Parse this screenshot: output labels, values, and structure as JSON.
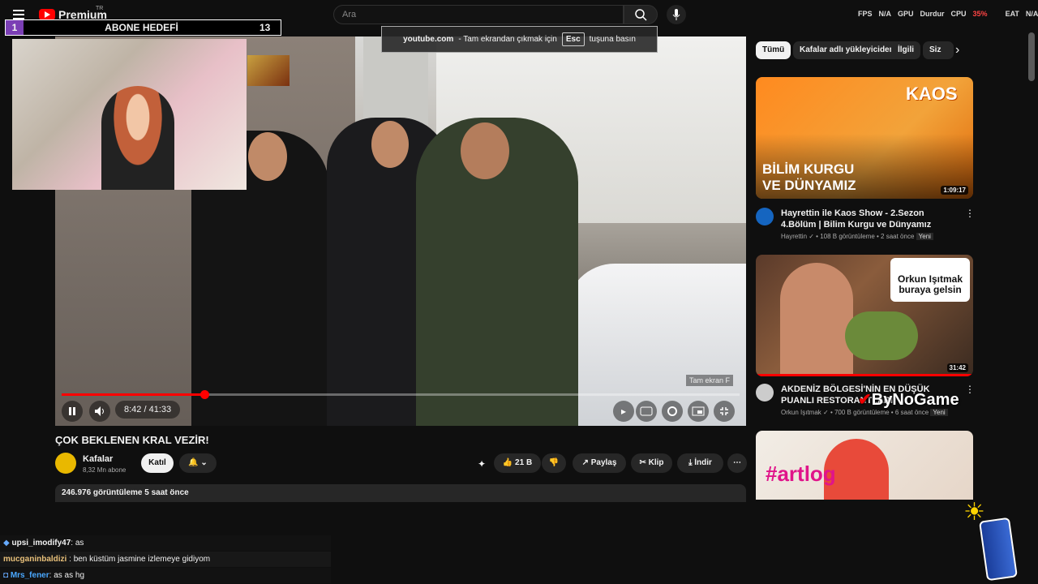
{
  "header": {
    "logo_text": "Premium",
    "country_code": "TR",
    "search_placeholder": "Ara",
    "hud_fps": "FPS",
    "hud_fps_value": "N/A",
    "hud_cpu": "CPU",
    "hud_cpu_value": "35%",
    "hud_gpu": "GPU",
    "hud_gpu_value": "Durdur",
    "hud_eat": "EAT",
    "hud_eat_value": "N/A"
  },
  "overlay": {
    "goal_index": "1",
    "goal_title": "ABONE HEDEFİ",
    "goal_count": "13",
    "fullscreen_site": "youtube.com",
    "fullscreen_msg_before": "- Tam ekrandan çıkmak için",
    "fullscreen_key": "Esc",
    "fullscreen_msg_after": "tuşuna basın",
    "fullscreen_hint": "Tam ekran",
    "fullscreen_hint_key": "F"
  },
  "player": {
    "time": "8:42 / 41:33",
    "progress": 0.21
  },
  "video": {
    "title": "ÇOK BEKLENEN KRAL VEZİR!",
    "channel": "Kafalar",
    "subscribers": "8,32 Mn abone",
    "join_label": "Katıl",
    "likes": "21 B",
    "share_label": "Paylaş",
    "clip_label": "Klip",
    "download_label": "İndir",
    "views_date": "246.976 görüntüleme  5 saat önce"
  },
  "sidebar": {
    "chips": [
      "Tümü",
      "Kafalar adlı yükleyiciden",
      "İlgili",
      "Siz"
    ],
    "videos": [
      {
        "thumb_title_line1": "BİLİM KURGU",
        "thumb_title_line2": "VE DÜNYAMIZ",
        "thumb_brand": "KAOS",
        "duration": "1:09:17",
        "title": "Hayrettin ile Kaos Show - 2.Sezon 4.Bölüm | Bilim Kurgu ve Dünyamız",
        "channel": "Hayrettin",
        "meta": "108 B görüntüleme • 2 saat önce",
        "badge": "Yeni"
      },
      {
        "thumb_caption": "Orkun Işıtmak buraya gelsin",
        "duration": "31:42",
        "title": "AKDENİZ BÖLGESİ'NİN EN DÜŞÜK PUANLI RESTORANTLARI!",
        "channel": "Orkun Işıtmak",
        "meta": "700 B görüntüleme • 6 saat önce",
        "badge": "Yeni"
      },
      {
        "thumb_caption": "#artlog"
      }
    ]
  },
  "watermark": "ByNoGame",
  "chat": [
    {
      "user": "upsi_imodify47",
      "message": "as",
      "color": "#f1f1f1"
    },
    {
      "user": "mucganinbaldizi",
      "message": "ben küstüm jasmine izlemeye gidiyom",
      "color": "#e8c07a"
    },
    {
      "user": "Mrs_fener",
      "message": "as as hg",
      "color": "#4aa8ff"
    }
  ]
}
